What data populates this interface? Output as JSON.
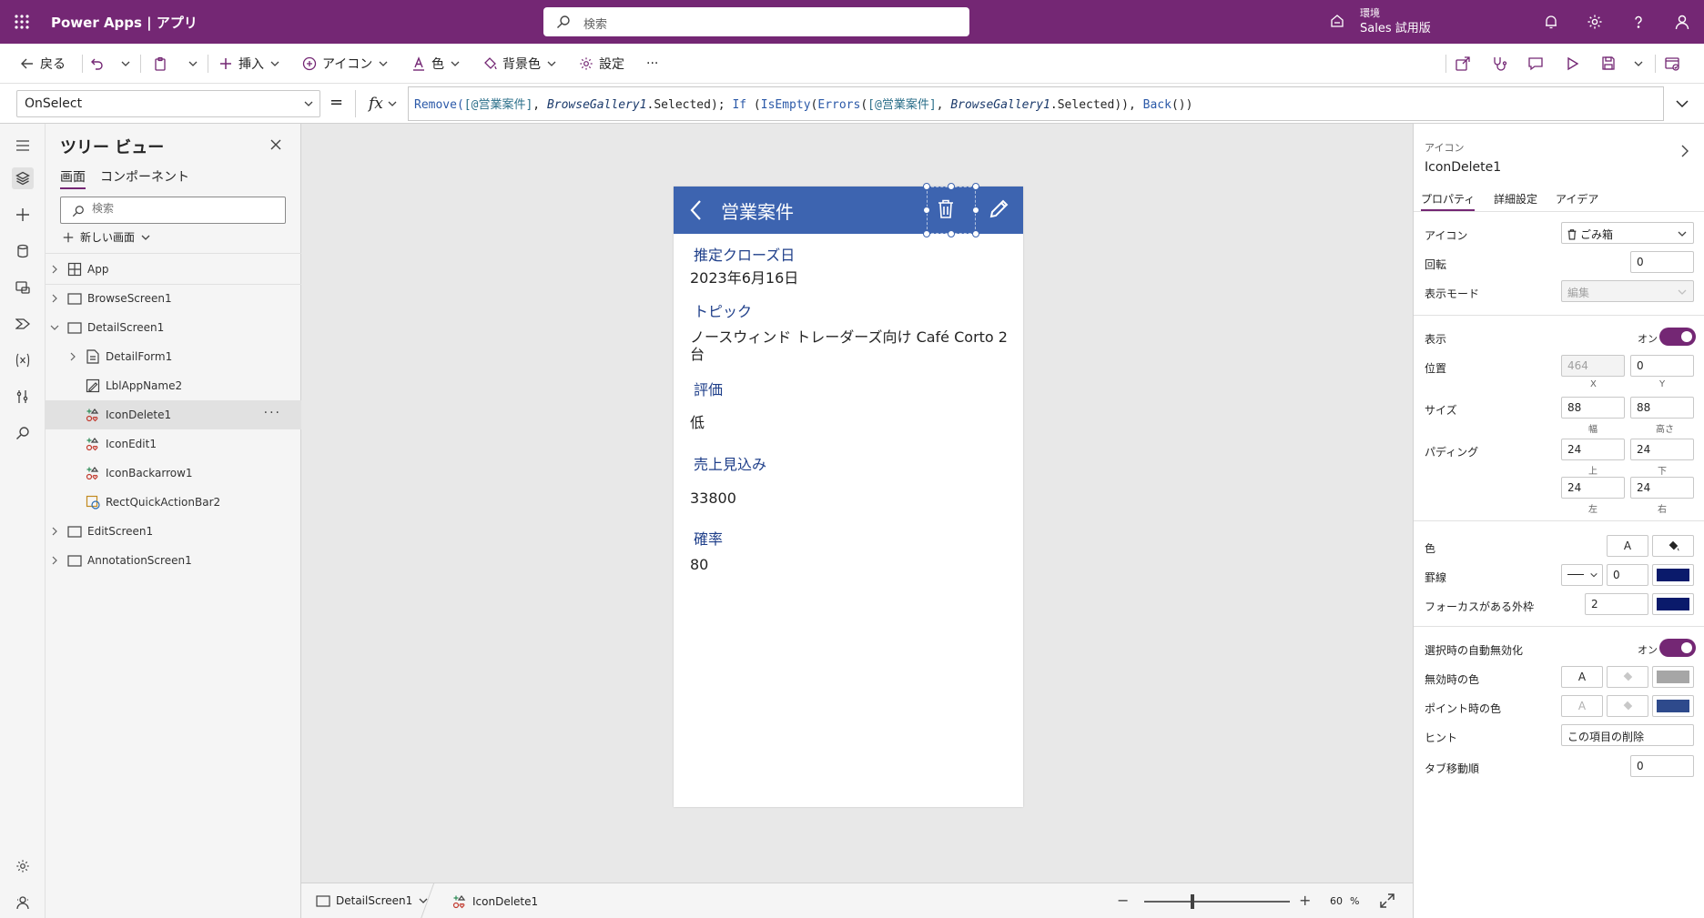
{
  "topbar": {
    "brand": "Power Apps  |  アプリ",
    "search_placeholder": "検索",
    "env_label": "環境",
    "env_name": "Sales 試用版"
  },
  "cmdbar": {
    "back": "戻る",
    "insert": "挿入",
    "icon": "アイコン",
    "color": "色",
    "background": "背景色",
    "settings": "設定",
    "more": "···"
  },
  "formula": {
    "property": "OnSelect",
    "equals": "=",
    "fx": "fx",
    "p1": "Remove(",
    "p2": "[@営業案件]",
    "p3": ", ",
    "p4": "BrowseGallery1",
    "p5": ".Selected); ",
    "p6": "If",
    "p7": " (",
    "p8": "IsEmpty",
    "p9": "(",
    "p10": "Errors",
    "p11": "(",
    "p12": "[@営業案件]",
    "p13": ", ",
    "p14": "BrowseGallery1",
    "p15": ".Selected)), ",
    "p16": "Back",
    "p17": "())"
  },
  "tree": {
    "title": "ツリー ビュー",
    "tab_screens": "画面",
    "tab_components": "コンポーネント",
    "search_placeholder": "検索",
    "new_screen": "新しい画面",
    "nodes": [
      {
        "label": "App"
      },
      {
        "label": "BrowseScreen1"
      },
      {
        "label": "DetailScreen1"
      },
      {
        "label": "DetailForm1"
      },
      {
        "label": "LblAppName2"
      },
      {
        "label": "IconDelete1"
      },
      {
        "label": "IconEdit1"
      },
      {
        "label": "IconBackarrow1"
      },
      {
        "label": "RectQuickActionBar2"
      },
      {
        "label": "EditScreen1"
      },
      {
        "label": "AnnotationScreen1"
      }
    ],
    "more": "···"
  },
  "phone": {
    "title": "営業案件",
    "fields": [
      {
        "label": "推定クローズ日",
        "value": "2023年6月16日"
      },
      {
        "label": "トピック",
        "value": "ノースウィンド トレーダーズ向け Café Corto 2 台"
      },
      {
        "label": "評価",
        "value": "低"
      },
      {
        "label": "売上見込み",
        "value": "33800"
      },
      {
        "label": "確率",
        "value": "80"
      }
    ]
  },
  "status": {
    "screen": "DetailScreen1",
    "control": "IconDelete1",
    "zoom_minus": "−",
    "zoom_plus": "+",
    "zoom_value": "60",
    "zoom_unit": "%"
  },
  "props": {
    "kind": "アイコン",
    "name": "IconDelete1",
    "tab_properties": "プロパティ",
    "tab_advanced": "詳細設定",
    "tab_ideas": "アイデア",
    "icon_label": "アイコン",
    "icon_value": "ごみ箱",
    "rotation_label": "回転",
    "rotation_value": "0",
    "display_mode_label": "表示モード",
    "display_mode_value": "編集",
    "visible_label": "表示",
    "visible_on": "オン",
    "position_label": "位置",
    "x_value": "464",
    "y_value": "0",
    "x_sub": "X",
    "y_sub": "Y",
    "size_label": "サイズ",
    "w_value": "88",
    "h_value": "88",
    "w_sub": "幅",
    "h_sub": "高さ",
    "padding_label": "パディング",
    "pad_top": "24",
    "pad_bottom": "24",
    "pad_left": "24",
    "pad_right": "24",
    "pad_top_sub": "上",
    "pad_bottom_sub": "下",
    "pad_left_sub": "左",
    "pad_right_sub": "右",
    "color_label": "色",
    "color_a": "A",
    "border_label": "罫線",
    "border_value": "0",
    "focus_label": "フォーカスがある外枠",
    "focus_value": "2",
    "auto_disable_label": "選択時の自動無効化",
    "auto_disable_on": "オン",
    "disabled_color_label": "無効時の色",
    "hover_color_label": "ポイント時の色",
    "tooltip_label": "ヒント",
    "tooltip_value": "この項目の削除",
    "tab_index_label": "タブ移動順",
    "tab_index_value": "0",
    "colors": {
      "fill": "#0a1a6b",
      "border": "#0a1a6b",
      "focus": "#0a1a6b",
      "disabled": "#a6a6a6",
      "hover": "#2e4a8c",
      "toggle": "#742774"
    }
  }
}
